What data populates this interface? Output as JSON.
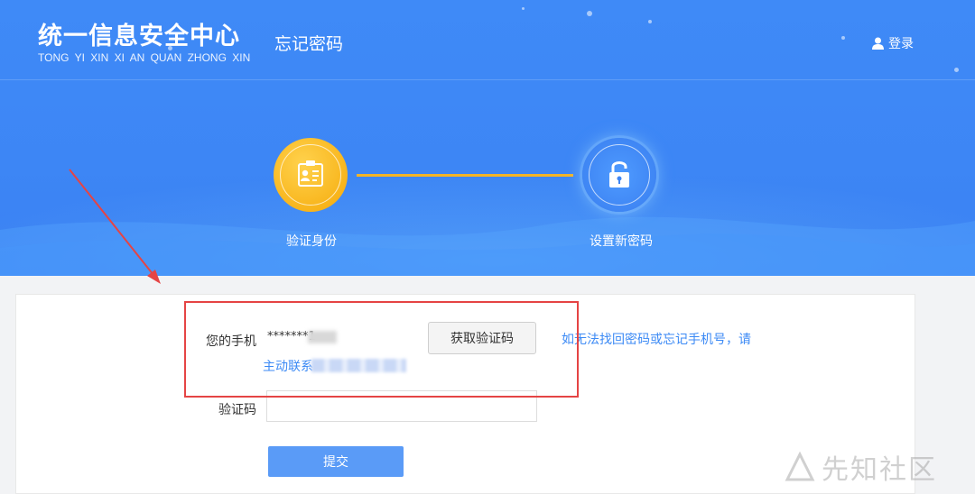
{
  "header": {
    "logo_cn": "统一信息安全中心",
    "logo_en": "TONG  YI   XIN XI AN QUAN ZHONG XIN",
    "page_title": "忘记密码",
    "login_label": "登录"
  },
  "steps": [
    {
      "label": "验证身份",
      "icon": "id-card-icon",
      "state": "active",
      "color": "#f8b51c"
    },
    {
      "label": "设置新密码",
      "icon": "lock-icon",
      "state": "pending",
      "color": "#3f86f4"
    }
  ],
  "form": {
    "phone_label": "您的手机",
    "phone_value": "*******1",
    "get_code_label": "获取验证码",
    "help_text_1": "如无法找回密码或忘记手机号，请",
    "help_text_2": "主动联系",
    "code_label": "验证码",
    "code_value": "",
    "submit_label": "提交"
  },
  "watermark": "先知社区",
  "colors": {
    "hero": "#3d86f5",
    "accent": "#3c8af5",
    "step_active": "#f8b51c",
    "highlight": "#e54444",
    "submit": "#5a9bf7"
  }
}
